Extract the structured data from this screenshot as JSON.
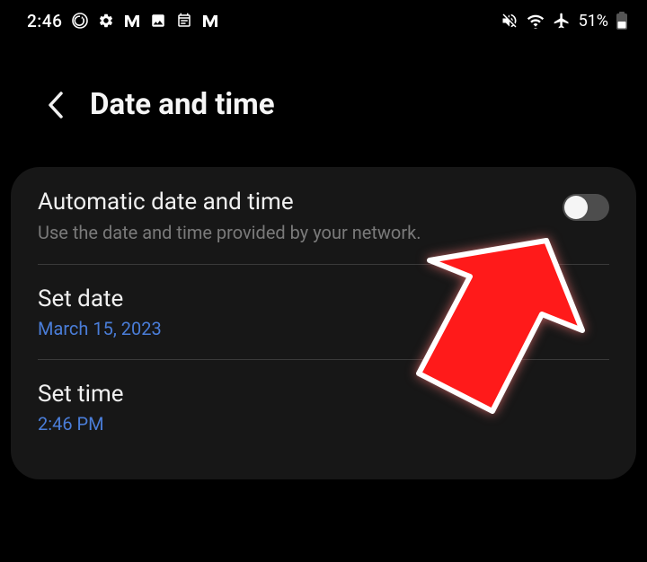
{
  "statusBar": {
    "time": "2:46",
    "batteryText": "51%"
  },
  "header": {
    "title": "Date and time"
  },
  "settings": {
    "auto": {
      "title": "Automatic date and time",
      "subtitle": "Use the date and time provided by your network."
    },
    "setDate": {
      "title": "Set date",
      "value": "March 15, 2023"
    },
    "setTime": {
      "title": "Set time",
      "value": "2:46 PM"
    }
  }
}
